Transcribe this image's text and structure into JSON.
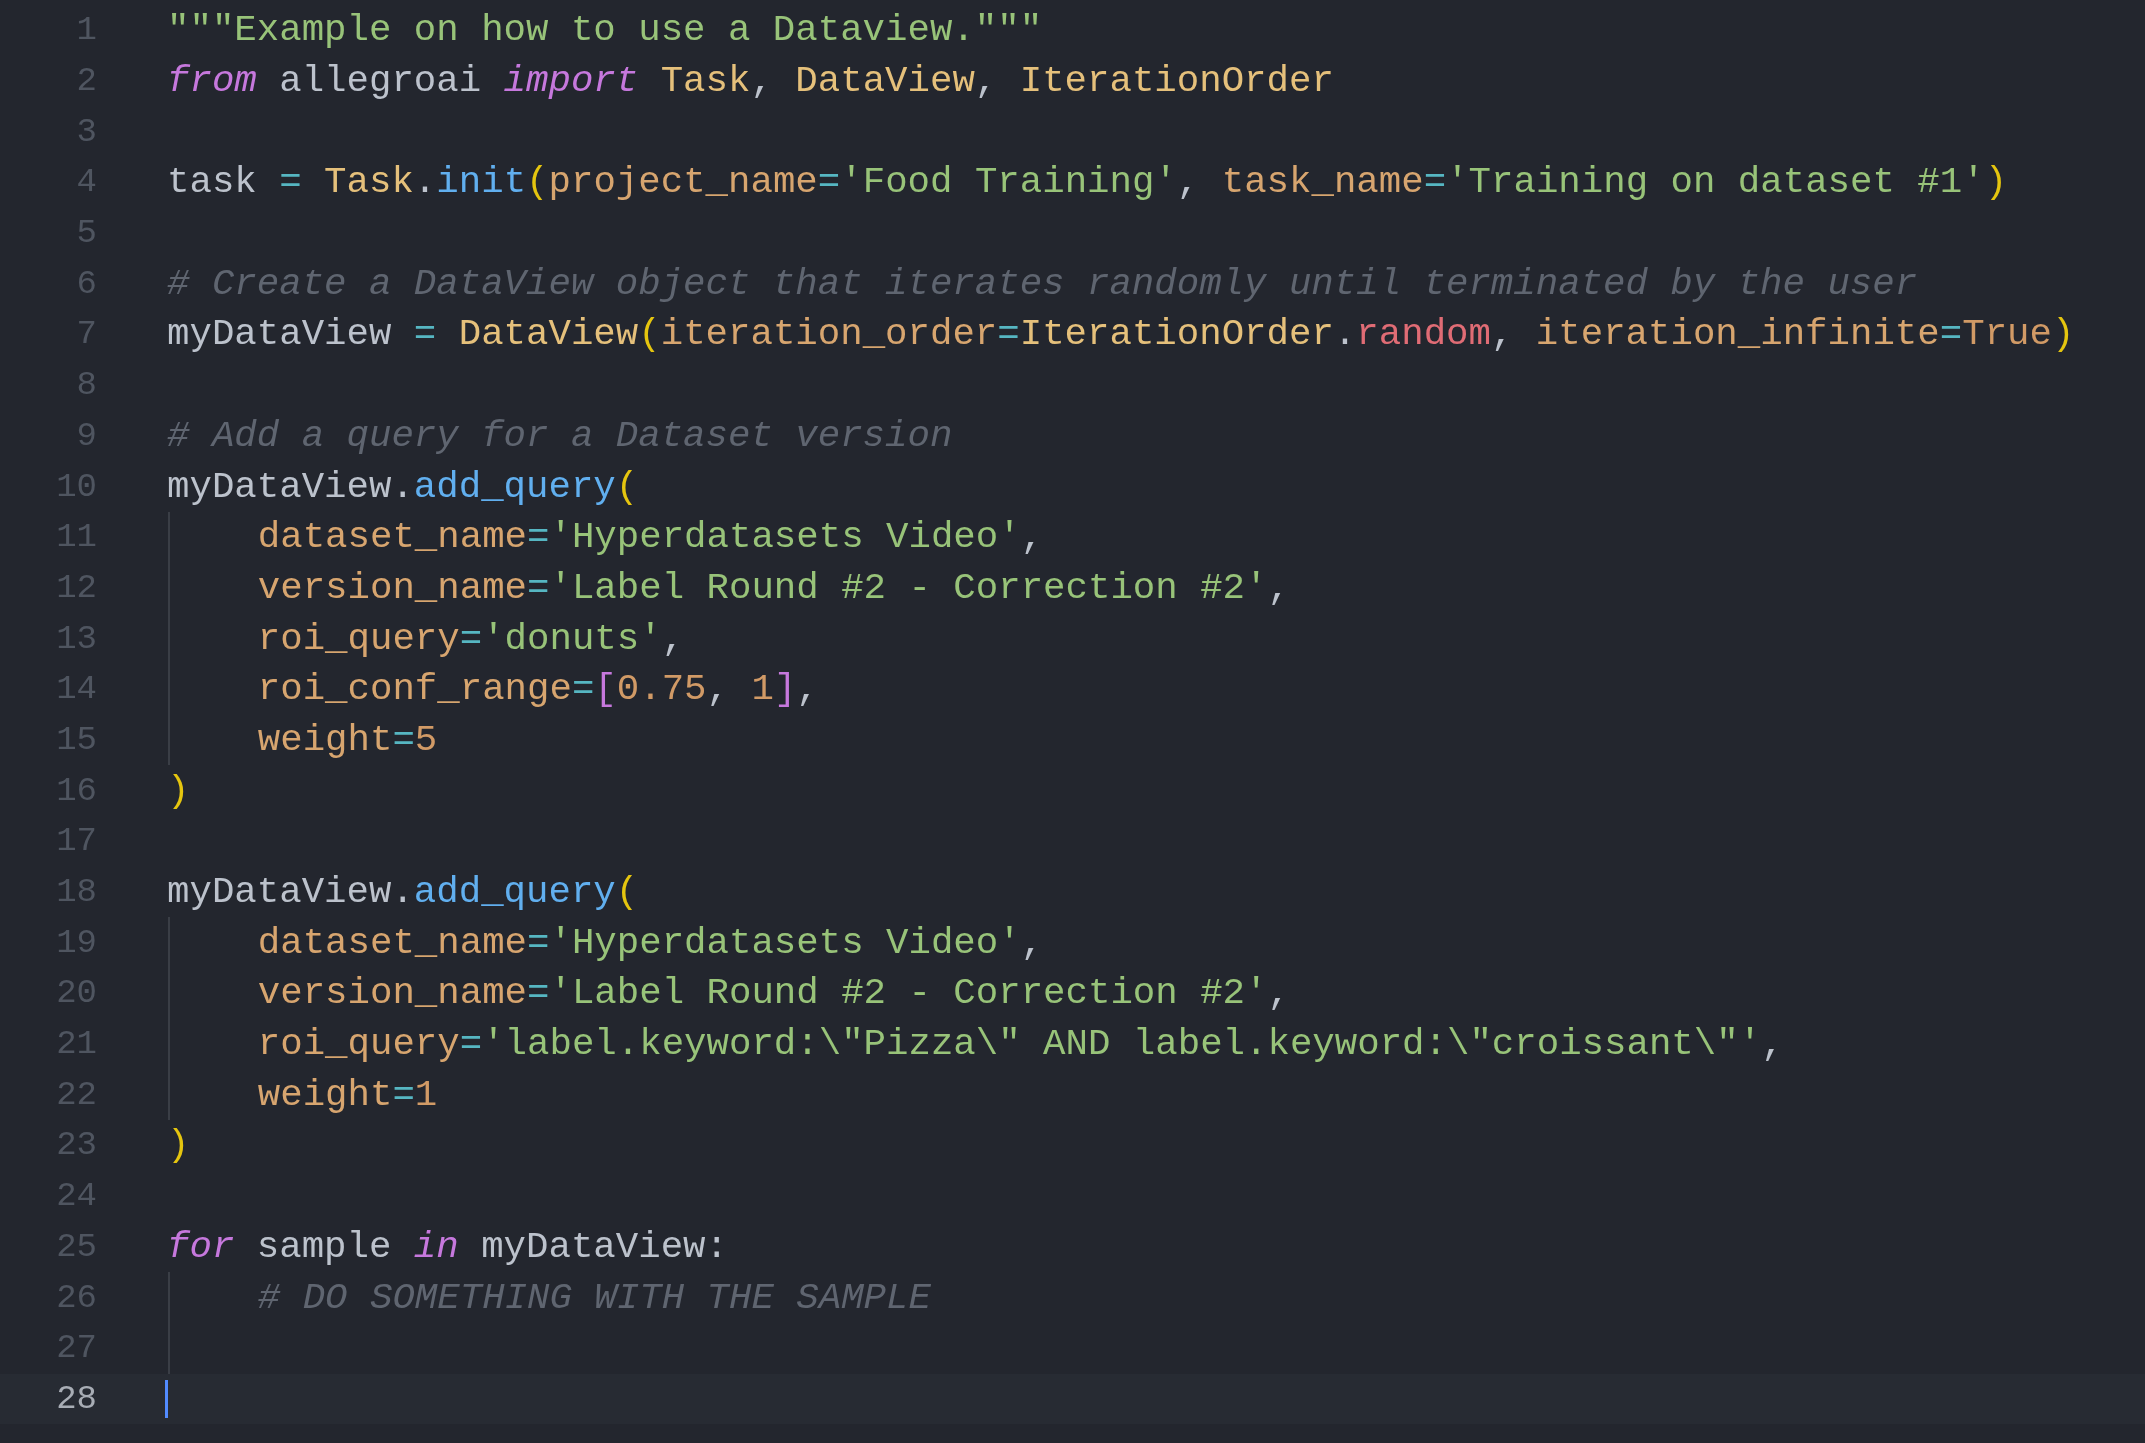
{
  "lines": [
    {
      "number": "1",
      "tokens": [
        {
          "text": "\"\"\"Example on how to use a Dataview.\"\"\"",
          "kind": "string"
        }
      ]
    },
    {
      "number": "2",
      "tokens": [
        {
          "text": "from",
          "kind": "keyword"
        },
        {
          "text": " allegroai ",
          "kind": "plain"
        },
        {
          "text": "import ",
          "kind": "keyword"
        },
        {
          "text": "Task",
          "kind": "class"
        },
        {
          "text": ", ",
          "kind": "plain"
        },
        {
          "text": "DataView",
          "kind": "class"
        },
        {
          "text": ", ",
          "kind": "plain"
        },
        {
          "text": "IterationOrder",
          "kind": "class"
        }
      ]
    },
    {
      "number": "3"
    },
    {
      "number": "4",
      "tokens": [
        {
          "text": "task",
          "kind": "plain"
        },
        {
          "text": " = ",
          "kind": "operator"
        },
        {
          "text": "Task",
          "kind": "class"
        },
        {
          "text": ".",
          "kind": "plain"
        },
        {
          "text": "init",
          "kind": "function"
        },
        {
          "text": "(",
          "kind": "paren"
        },
        {
          "text": "project_name",
          "kind": "param"
        },
        {
          "text": "=",
          "kind": "operator"
        },
        {
          "text": "'Food Training'",
          "kind": "string"
        },
        {
          "text": ", ",
          "kind": "plain"
        },
        {
          "text": "task_name",
          "kind": "param"
        },
        {
          "text": "=",
          "kind": "operator"
        },
        {
          "text": "'Training on dataset #1'",
          "kind": "string"
        },
        {
          "text": ")",
          "kind": "paren"
        }
      ]
    },
    {
      "number": "5"
    },
    {
      "number": "6",
      "tokens": [
        {
          "text": "# Create a DataView object that iterates randomly until terminated by the user",
          "kind": "comment"
        }
      ]
    },
    {
      "number": "7",
      "tokens": [
        {
          "text": "myDataView",
          "kind": "plain"
        },
        {
          "text": " = ",
          "kind": "operator"
        },
        {
          "text": "DataView",
          "kind": "class"
        },
        {
          "text": "(",
          "kind": "paren"
        },
        {
          "text": "iteration_order",
          "kind": "param"
        },
        {
          "text": "=",
          "kind": "operator"
        },
        {
          "text": "IterationOrder",
          "kind": "class"
        },
        {
          "text": ".",
          "kind": "plain"
        },
        {
          "text": "random",
          "kind": "attribute"
        },
        {
          "text": ", ",
          "kind": "plain"
        },
        {
          "text": "iteration_infinite",
          "kind": "param"
        },
        {
          "text": "=",
          "kind": "operator"
        },
        {
          "text": "True",
          "kind": "constant"
        },
        {
          "text": ")",
          "kind": "paren"
        }
      ]
    },
    {
      "number": "8"
    },
    {
      "number": "9",
      "tokens": [
        {
          "text": "# Add a query for a Dataset version",
          "kind": "comment"
        }
      ]
    },
    {
      "number": "10",
      "tokens": [
        {
          "text": "myDataView",
          "kind": "plain"
        },
        {
          "text": ".",
          "kind": "plain"
        },
        {
          "text": "add_query",
          "kind": "function"
        },
        {
          "text": "(",
          "kind": "paren"
        }
      ]
    },
    {
      "number": "11",
      "indented": true,
      "tokens": [
        {
          "text": "dataset_name",
          "kind": "param"
        },
        {
          "text": "=",
          "kind": "operator"
        },
        {
          "text": "'Hyperdatasets Video'",
          "kind": "string"
        },
        {
          "text": ",",
          "kind": "plain"
        }
      ]
    },
    {
      "number": "12",
      "indented": true,
      "tokens": [
        {
          "text": "version_name",
          "kind": "param"
        },
        {
          "text": "=",
          "kind": "operator"
        },
        {
          "text": "'Label Round #2 - Correction #2'",
          "kind": "string"
        },
        {
          "text": ",",
          "kind": "plain"
        }
      ]
    },
    {
      "number": "13",
      "indented": true,
      "tokens": [
        {
          "text": "roi_query",
          "kind": "param"
        },
        {
          "text": "=",
          "kind": "operator"
        },
        {
          "text": "'donuts'",
          "kind": "string"
        },
        {
          "text": ",",
          "kind": "plain"
        }
      ]
    },
    {
      "number": "14",
      "indented": true,
      "tokens": [
        {
          "text": "roi_conf_range",
          "kind": "param"
        },
        {
          "text": "=",
          "kind": "operator"
        },
        {
          "text": "[",
          "kind": "bracket"
        },
        {
          "text": "0.75",
          "kind": "constant"
        },
        {
          "text": ", ",
          "kind": "plain"
        },
        {
          "text": "1",
          "kind": "constant"
        },
        {
          "text": "]",
          "kind": "bracket"
        },
        {
          "text": ",",
          "kind": "plain"
        }
      ]
    },
    {
      "number": "15",
      "indented": true,
      "tokens": [
        {
          "text": "weight",
          "kind": "param"
        },
        {
          "text": "=",
          "kind": "operator"
        },
        {
          "text": "5",
          "kind": "constant"
        }
      ]
    },
    {
      "number": "16",
      "tokens": [
        {
          "text": ")",
          "kind": "paren"
        }
      ]
    },
    {
      "number": "17"
    },
    {
      "number": "18",
      "tokens": [
        {
          "text": "myDataView",
          "kind": "plain"
        },
        {
          "text": ".",
          "kind": "plain"
        },
        {
          "text": "add_query",
          "kind": "function"
        },
        {
          "text": "(",
          "kind": "paren"
        }
      ]
    },
    {
      "number": "19",
      "indented": true,
      "tokens": [
        {
          "text": "dataset_name",
          "kind": "param"
        },
        {
          "text": "=",
          "kind": "operator"
        },
        {
          "text": "'Hyperdatasets Video'",
          "kind": "string"
        },
        {
          "text": ",",
          "kind": "plain"
        }
      ]
    },
    {
      "number": "20",
      "indented": true,
      "tokens": [
        {
          "text": "version_name",
          "kind": "param"
        },
        {
          "text": "=",
          "kind": "operator"
        },
        {
          "text": "'Label Round #2 - Correction #2'",
          "kind": "string"
        },
        {
          "text": ",",
          "kind": "plain"
        }
      ]
    },
    {
      "number": "21",
      "indented": true,
      "tokens": [
        {
          "text": "roi_query",
          "kind": "param"
        },
        {
          "text": "=",
          "kind": "operator"
        },
        {
          "text": "'label.keyword:\\\"Pizza\\\" AND label.keyword:\\\"croissant\\\"'",
          "kind": "string"
        },
        {
          "text": ",",
          "kind": "plain"
        }
      ]
    },
    {
      "number": "22",
      "indented": true,
      "tokens": [
        {
          "text": "weight",
          "kind": "param"
        },
        {
          "text": "=",
          "kind": "operator"
        },
        {
          "text": "1",
          "kind": "constant"
        }
      ]
    },
    {
      "number": "23",
      "tokens": [
        {
          "text": ")",
          "kind": "paren"
        }
      ]
    },
    {
      "number": "24"
    },
    {
      "number": "25",
      "tokens": [
        {
          "text": "for",
          "kind": "keyword"
        },
        {
          "text": " sample ",
          "kind": "plain"
        },
        {
          "text": "in",
          "kind": "keyword"
        },
        {
          "text": " myDataView:",
          "kind": "plain"
        }
      ]
    },
    {
      "number": "26",
      "indented": true,
      "tokens": [
        {
          "text": "# DO SOMETHING WITH THE SAMPLE",
          "kind": "comment"
        }
      ]
    },
    {
      "number": "27",
      "indented": true
    },
    {
      "number": "28",
      "current": true
    }
  ]
}
